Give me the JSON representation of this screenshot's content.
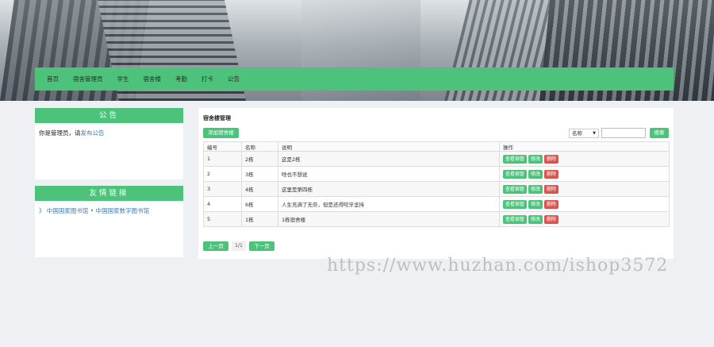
{
  "nav": [
    "首页",
    "宿舍管理员",
    "学生",
    "宿舍楼",
    "考勤",
    "打卡",
    "公告"
  ],
  "notice": {
    "title": "公告",
    "text": "你是管理员，请",
    "link": "发布公告"
  },
  "friend": {
    "title": "友情链接",
    "prefix": "》",
    "links": "中国国家图书馆 • 中国国家数字图书馆"
  },
  "main": {
    "title": "宿舍楼管理",
    "add_label": "添加宿舍楼",
    "select_value": "名称",
    "search_label": "搜索",
    "headers": [
      "编号",
      "名称",
      "说明",
      "操作"
    ],
    "rows": [
      {
        "id": "1",
        "name": "2栋",
        "desc": "这是2栋"
      },
      {
        "id": "2",
        "name": "3栋",
        "desc": "啥也不想说"
      },
      {
        "id": "3",
        "name": "4栋",
        "desc": "这里是第四栋"
      },
      {
        "id": "4",
        "name": "6栋",
        "desc": "人生充满了无奈，但是还得咬牙坚持"
      },
      {
        "id": "5",
        "name": "1栋",
        "desc": "1栋宿舍楼"
      }
    ],
    "actions": {
      "view": "查看宿管",
      "edit": "修改",
      "delete": "删除"
    },
    "pager": {
      "prev": "上一页",
      "page": "1/1",
      "next": "下一页"
    }
  },
  "watermark": "https://www.huzhan.com/ishop3572"
}
